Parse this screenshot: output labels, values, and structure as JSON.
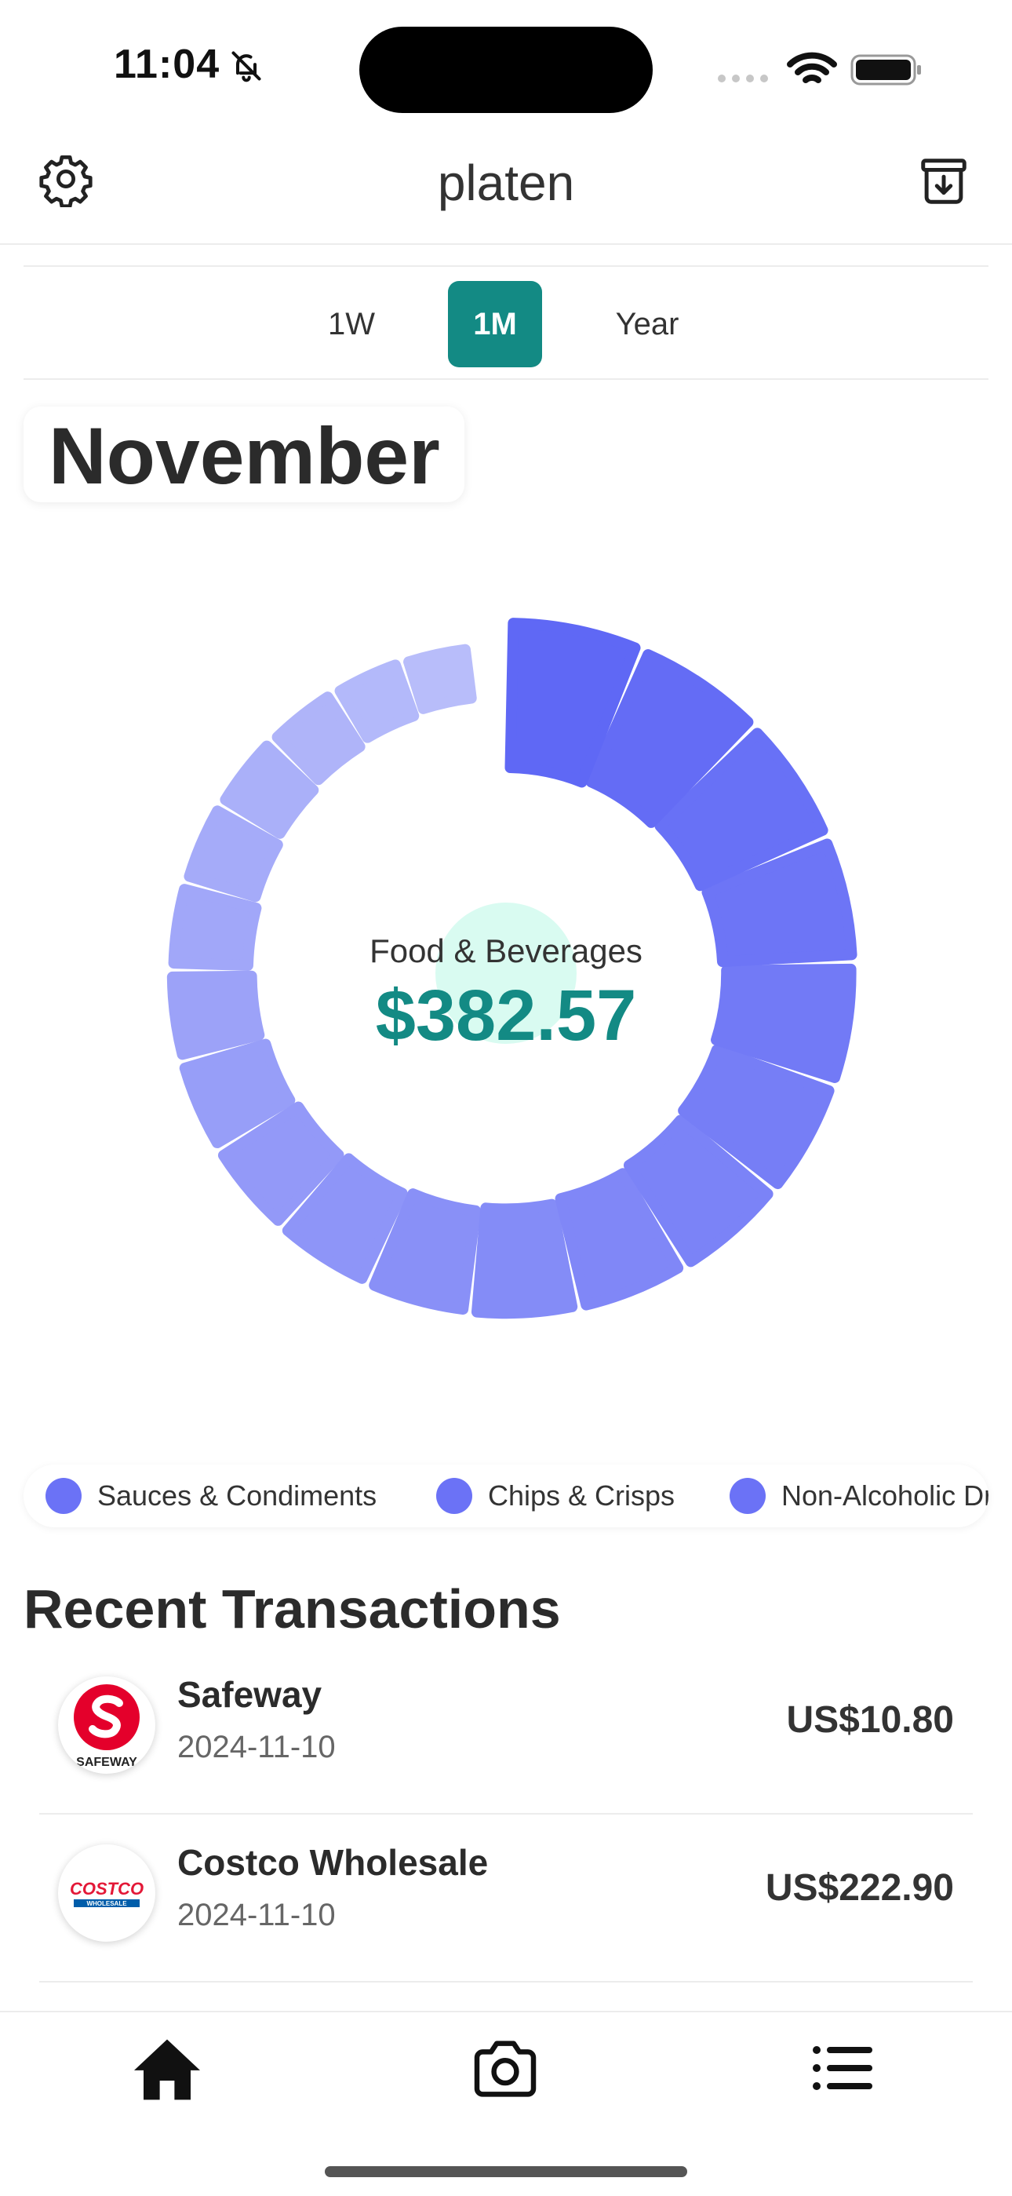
{
  "status_bar": {
    "time": "11:04",
    "icons": [
      "bell-slash-icon",
      "signal-icon",
      "wifi-icon",
      "battery-icon"
    ]
  },
  "header": {
    "title": "platen",
    "left_icon": "gear-icon",
    "right_icon": "archive-download-icon"
  },
  "period_selector": {
    "options": [
      "1W",
      "1M",
      "Year"
    ],
    "selected": "1M"
  },
  "month": "November",
  "donut": {
    "center_label": "Food & Beverages",
    "center_value": "$382.57"
  },
  "legend": [
    {
      "label": "Sauces & Condiments",
      "color": "#6b72f6"
    },
    {
      "label": "Chips & Crisps",
      "color": "#6b72f6"
    },
    {
      "label": "Non-Alcoholic Drinks",
      "color": "#6b72f6"
    }
  ],
  "transactions": {
    "title": "Recent Transactions",
    "items": [
      {
        "merchant": "Safeway",
        "date": "2024-11-10",
        "amount": "US$10.80",
        "logo_text": "SAFEWAY"
      },
      {
        "merchant": "Costco Wholesale",
        "date": "2024-11-10",
        "amount": "US$222.90",
        "logo_text": "COSTCO",
        "logo_subtext": "WHOLESALE"
      }
    ]
  },
  "tab_bar": {
    "tabs": [
      "home-icon",
      "camera-icon",
      "list-icon"
    ],
    "selected": "home-icon"
  },
  "colors": {
    "accent": "#138a84",
    "donut_start": "#5f68f5",
    "donut_end": "#b8bdfa"
  }
}
